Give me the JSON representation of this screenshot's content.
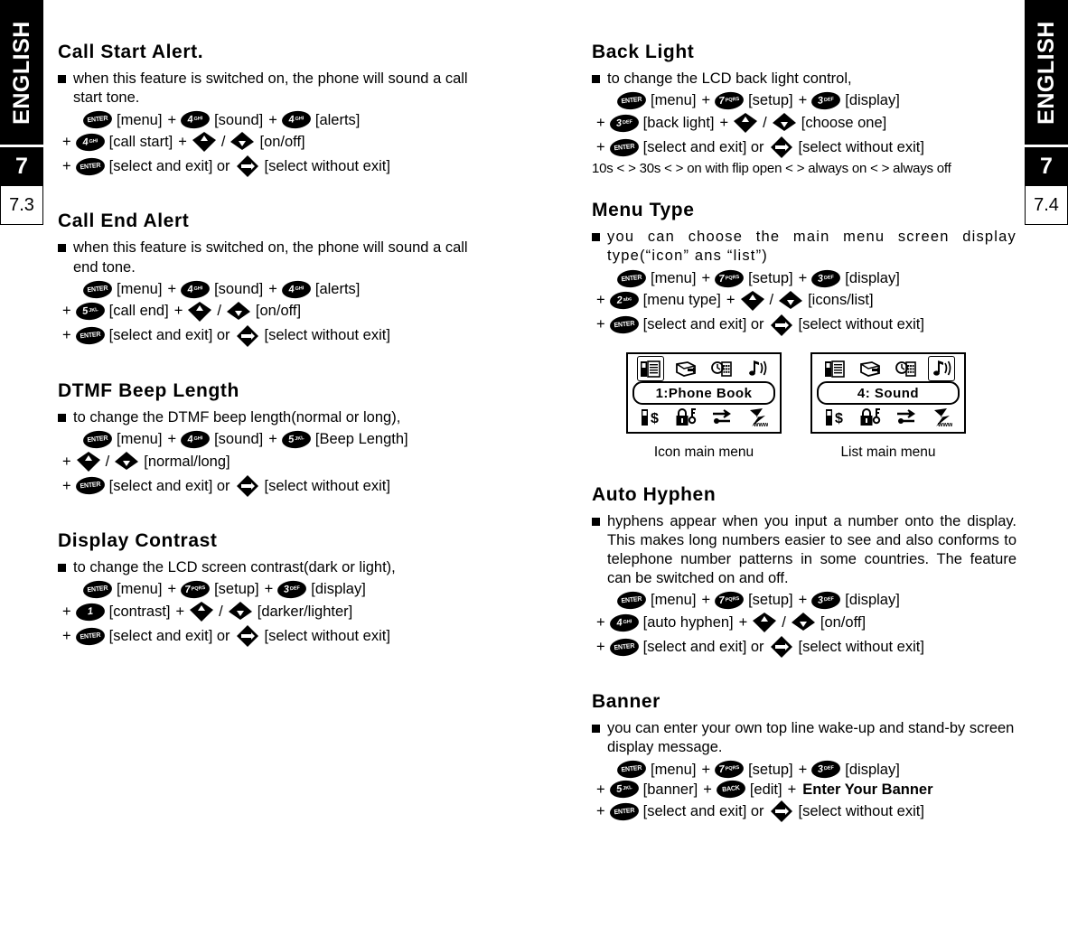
{
  "sidebars": {
    "left": {
      "language": "ENGLISH",
      "chapter": "7",
      "section": "7.3"
    },
    "right": {
      "language": "ENGLISH",
      "chapter": "7",
      "section": "7.4"
    }
  },
  "keys": {
    "enter": "ENTER",
    "back": "BACK",
    "one": {
      "num": "1",
      "sub": ""
    },
    "two": {
      "num": "2",
      "sub": "abc"
    },
    "three": {
      "num": "3",
      "sub": "DEF"
    },
    "four": {
      "num": "4",
      "sub": "GHI"
    },
    "five": {
      "num": "5",
      "sub": "JKL"
    },
    "seven": {
      "num": "7",
      "sub": "PQRS"
    }
  },
  "left_column": [
    {
      "id": "call-start-alert",
      "title": "Call Start Alert.",
      "body": "when this feature is switched on, the phone will sound a call start tone.",
      "steps": [
        {
          "indent": 0,
          "parts": [
            {
              "type": "key",
              "key": "enter"
            },
            {
              "type": "text",
              "value": "[menu]"
            },
            {
              "type": "text",
              "value": "+"
            },
            {
              "type": "key",
              "key": "four"
            },
            {
              "type": "text",
              "value": "[sound]"
            },
            {
              "type": "text",
              "value": "+"
            },
            {
              "type": "key",
              "key": "four"
            },
            {
              "type": "text",
              "value": "[alerts]"
            }
          ]
        },
        {
          "indent": 1,
          "parts": [
            {
              "type": "text",
              "value": "+"
            },
            {
              "type": "key",
              "key": "four"
            },
            {
              "type": "text",
              "value": "[call start]"
            },
            {
              "type": "text",
              "value": "+"
            },
            {
              "type": "key",
              "key": "up"
            },
            {
              "type": "text",
              "value": "/"
            },
            {
              "type": "key",
              "key": "down"
            },
            {
              "type": "text",
              "value": "[on/off]"
            }
          ]
        },
        {
          "indent": 1,
          "parts": [
            {
              "type": "text",
              "value": "+"
            },
            {
              "type": "key",
              "key": "enter"
            },
            {
              "type": "text",
              "value": "[select and exit] or"
            },
            {
              "type": "key",
              "key": "leftright"
            },
            {
              "type": "text",
              "value": "[select without exit]"
            }
          ]
        }
      ]
    },
    {
      "id": "call-end-alert",
      "title": "Call End Alert",
      "body": "when this feature is switched on, the phone will sound a call end tone.",
      "steps": [
        {
          "indent": 0,
          "parts": [
            {
              "type": "key",
              "key": "enter"
            },
            {
              "type": "text",
              "value": "[menu]"
            },
            {
              "type": "text",
              "value": "+"
            },
            {
              "type": "key",
              "key": "four"
            },
            {
              "type": "text",
              "value": "[sound]"
            },
            {
              "type": "text",
              "value": "+"
            },
            {
              "type": "key",
              "key": "four"
            },
            {
              "type": "text",
              "value": "[alerts]"
            }
          ]
        },
        {
          "indent": 1,
          "parts": [
            {
              "type": "text",
              "value": "+"
            },
            {
              "type": "key",
              "key": "five"
            },
            {
              "type": "text",
              "value": "[call end]"
            },
            {
              "type": "text",
              "value": "+"
            },
            {
              "type": "key",
              "key": "up"
            },
            {
              "type": "text",
              "value": "/"
            },
            {
              "type": "key",
              "key": "down"
            },
            {
              "type": "text",
              "value": "[on/off]"
            }
          ]
        },
        {
          "indent": 1,
          "parts": [
            {
              "type": "text",
              "value": "+"
            },
            {
              "type": "key",
              "key": "enter"
            },
            {
              "type": "text",
              "value": "[select and exit] or"
            },
            {
              "type": "key",
              "key": "leftright"
            },
            {
              "type": "text",
              "value": "[select without exit]"
            }
          ]
        }
      ]
    },
    {
      "id": "dtmf-beep-length",
      "title": "DTMF Beep Length",
      "body": "to change the DTMF beep length(normal or long),",
      "steps": [
        {
          "indent": 0,
          "parts": [
            {
              "type": "key",
              "key": "enter"
            },
            {
              "type": "text",
              "value": "[menu]"
            },
            {
              "type": "text",
              "value": "+"
            },
            {
              "type": "key",
              "key": "four"
            },
            {
              "type": "text",
              "value": "[sound]"
            },
            {
              "type": "text",
              "value": "+"
            },
            {
              "type": "key",
              "key": "five"
            },
            {
              "type": "text",
              "value": "[Beep Length]"
            }
          ]
        },
        {
          "indent": 1,
          "parts": [
            {
              "type": "text",
              "value": "+"
            },
            {
              "type": "key",
              "key": "up"
            },
            {
              "type": "text",
              "value": "/"
            },
            {
              "type": "key",
              "key": "down"
            },
            {
              "type": "text",
              "value": "[normal/long]"
            }
          ]
        },
        {
          "indent": 1,
          "parts": [
            {
              "type": "text",
              "value": "+"
            },
            {
              "type": "key",
              "key": "enter"
            },
            {
              "type": "text",
              "value": "[select and exit] or"
            },
            {
              "type": "key",
              "key": "leftright"
            },
            {
              "type": "text",
              "value": "[select without exit]"
            }
          ]
        }
      ]
    },
    {
      "id": "display-contrast",
      "title": "Display Contrast",
      "body": "to change the LCD screen contrast(dark or light),",
      "steps": [
        {
          "indent": 0,
          "parts": [
            {
              "type": "key",
              "key": "enter"
            },
            {
              "type": "text",
              "value": "[menu]"
            },
            {
              "type": "text",
              "value": "+"
            },
            {
              "type": "key",
              "key": "seven"
            },
            {
              "type": "text",
              "value": "[setup]"
            },
            {
              "type": "text",
              "value": "+"
            },
            {
              "type": "key",
              "key": "three"
            },
            {
              "type": "text",
              "value": "[display]"
            }
          ]
        },
        {
          "indent": 1,
          "parts": [
            {
              "type": "text",
              "value": "+"
            },
            {
              "type": "key",
              "key": "one"
            },
            {
              "type": "text",
              "value": "[contrast]"
            },
            {
              "type": "text",
              "value": "+"
            },
            {
              "type": "key",
              "key": "up"
            },
            {
              "type": "text",
              "value": "/"
            },
            {
              "type": "key",
              "key": "down"
            },
            {
              "type": "text",
              "value": "[darker/lighter]"
            }
          ]
        },
        {
          "indent": 1,
          "parts": [
            {
              "type": "text",
              "value": "+"
            },
            {
              "type": "key",
              "key": "enter"
            },
            {
              "type": "text",
              "value": "[select and exit] or"
            },
            {
              "type": "key",
              "key": "leftright"
            },
            {
              "type": "text",
              "value": "[select without exit]"
            }
          ]
        }
      ]
    }
  ],
  "right_column": [
    {
      "id": "back-light",
      "title": "Back Light",
      "body": "to change the LCD back light control,",
      "note": "10s < > 30s < > on with flip open < > always on < > always off",
      "steps": [
        {
          "indent": 0,
          "parts": [
            {
              "type": "key",
              "key": "enter"
            },
            {
              "type": "text",
              "value": "[menu]"
            },
            {
              "type": "text",
              "value": "+"
            },
            {
              "type": "key",
              "key": "seven"
            },
            {
              "type": "text",
              "value": "[setup]"
            },
            {
              "type": "text",
              "value": "+"
            },
            {
              "type": "key",
              "key": "three"
            },
            {
              "type": "text",
              "value": "[display]"
            }
          ]
        },
        {
          "indent": 1,
          "parts": [
            {
              "type": "text",
              "value": "+"
            },
            {
              "type": "key",
              "key": "three"
            },
            {
              "type": "text",
              "value": "[back light]"
            },
            {
              "type": "text",
              "value": "+"
            },
            {
              "type": "key",
              "key": "up"
            },
            {
              "type": "text",
              "value": "/"
            },
            {
              "type": "key",
              "key": "down"
            },
            {
              "type": "text",
              "value": "[choose one]"
            }
          ]
        },
        {
          "indent": 1,
          "parts": [
            {
              "type": "text",
              "value": "+"
            },
            {
              "type": "key",
              "key": "enter"
            },
            {
              "type": "text",
              "value": "[select and exit] or"
            },
            {
              "type": "key",
              "key": "leftright"
            },
            {
              "type": "text",
              "value": "[select without exit]"
            }
          ]
        }
      ]
    },
    {
      "id": "menu-type",
      "title": "Menu Type",
      "body": "you can choose the main menu screen display type(“icon” ans “list”)",
      "steps": [
        {
          "indent": 0,
          "parts": [
            {
              "type": "key",
              "key": "enter"
            },
            {
              "type": "text",
              "value": "[menu]"
            },
            {
              "type": "text",
              "value": "+"
            },
            {
              "type": "key",
              "key": "seven"
            },
            {
              "type": "text",
              "value": "[setup]"
            },
            {
              "type": "text",
              "value": "+"
            },
            {
              "type": "key",
              "key": "three"
            },
            {
              "type": "text",
              "value": "[display]"
            }
          ]
        },
        {
          "indent": 1,
          "parts": [
            {
              "type": "text",
              "value": "+"
            },
            {
              "type": "key",
              "key": "two"
            },
            {
              "type": "text",
              "value": "[menu type]"
            },
            {
              "type": "text",
              "value": "+"
            },
            {
              "type": "key",
              "key": "up"
            },
            {
              "type": "text",
              "value": "/"
            },
            {
              "type": "key",
              "key": "down"
            },
            {
              "type": "text",
              "value": "[icons/list]"
            }
          ]
        },
        {
          "indent": 1,
          "parts": [
            {
              "type": "text",
              "value": "+"
            },
            {
              "type": "key",
              "key": "enter"
            },
            {
              "type": "text",
              "value": "[select and exit] or"
            },
            {
              "type": "key",
              "key": "leftright"
            },
            {
              "type": "text",
              "value": "[select without exit]"
            }
          ]
        }
      ]
    },
    {
      "id": "auto-hyphen",
      "title": "Auto Hyphen",
      "body": "hyphens appear when you input a number onto the display. This makes long numbers easier to see and also conforms to telephone number patterns in some countries. The feature can be switched on and off.",
      "steps": [
        {
          "indent": 0,
          "parts": [
            {
              "type": "key",
              "key": "enter"
            },
            {
              "type": "text",
              "value": "[menu]"
            },
            {
              "type": "text",
              "value": "+"
            },
            {
              "type": "key",
              "key": "seven"
            },
            {
              "type": "text",
              "value": "[setup]"
            },
            {
              "type": "text",
              "value": "+"
            },
            {
              "type": "key",
              "key": "three"
            },
            {
              "type": "text",
              "value": "[display]"
            }
          ]
        },
        {
          "indent": 1,
          "parts": [
            {
              "type": "text",
              "value": "+"
            },
            {
              "type": "key",
              "key": "four"
            },
            {
              "type": "text",
              "value": "[auto hyphen]"
            },
            {
              "type": "text",
              "value": "+"
            },
            {
              "type": "key",
              "key": "up"
            },
            {
              "type": "text",
              "value": "/"
            },
            {
              "type": "key",
              "key": "down"
            },
            {
              "type": "text",
              "value": "[on/off]"
            }
          ]
        },
        {
          "indent": 1,
          "parts": [
            {
              "type": "text",
              "value": "+"
            },
            {
              "type": "key",
              "key": "enter"
            },
            {
              "type": "text",
              "value": "[select and exit] or"
            },
            {
              "type": "key",
              "key": "leftright"
            },
            {
              "type": "text",
              "value": "[select without exit]"
            }
          ]
        }
      ]
    },
    {
      "id": "banner",
      "title": "Banner",
      "body": "you can enter your own top line wake-up and stand-by screen display message.",
      "steps": [
        {
          "indent": 0,
          "parts": [
            {
              "type": "key",
              "key": "enter"
            },
            {
              "type": "text",
              "value": "[menu]"
            },
            {
              "type": "text",
              "value": "+"
            },
            {
              "type": "key",
              "key": "seven"
            },
            {
              "type": "text",
              "value": "[setup]"
            },
            {
              "type": "text",
              "value": "+"
            },
            {
              "type": "key",
              "key": "three"
            },
            {
              "type": "text",
              "value": "[display]"
            }
          ]
        },
        {
          "indent": 1,
          "parts": [
            {
              "type": "text",
              "value": "+"
            },
            {
              "type": "key",
              "key": "five"
            },
            {
              "type": "text",
              "value": "[banner]"
            },
            {
              "type": "text",
              "value": "+"
            },
            {
              "type": "key",
              "key": "back"
            },
            {
              "type": "text",
              "value": "[edit]"
            },
            {
              "type": "text",
              "value": "+"
            },
            {
              "type": "bold",
              "value": "Enter Your Banner"
            }
          ]
        },
        {
          "indent": 1,
          "parts": [
            {
              "type": "text",
              "value": "+"
            },
            {
              "type": "key",
              "key": "enter"
            },
            {
              "type": "text",
              "value": "[select and exit] or"
            },
            {
              "type": "key",
              "key": "leftright"
            },
            {
              "type": "text",
              "value": "[select without exit]"
            }
          ]
        }
      ]
    }
  ],
  "lcd_figures": [
    {
      "id": "icon-main-menu",
      "label": "1:Phone  Book",
      "caption": "Icon main menu",
      "highlight_index": 0,
      "top_icons": [
        "phonebook-icon",
        "message-icon",
        "clock-phone-icon",
        "music-note-icon"
      ],
      "bottom_icons": [
        "phone-dollar-icon",
        "lock-key-icon",
        "settings-icon",
        "www-icon"
      ]
    },
    {
      "id": "list-main-menu",
      "label": "4: Sound",
      "caption": "List main menu",
      "highlight_index": 3,
      "top_icons": [
        "phonebook-icon",
        "message-icon",
        "clock-phone-icon",
        "music-note-icon"
      ],
      "bottom_icons": [
        "phone-dollar-icon",
        "lock-key-icon",
        "settings-icon",
        "www-icon"
      ]
    }
  ]
}
